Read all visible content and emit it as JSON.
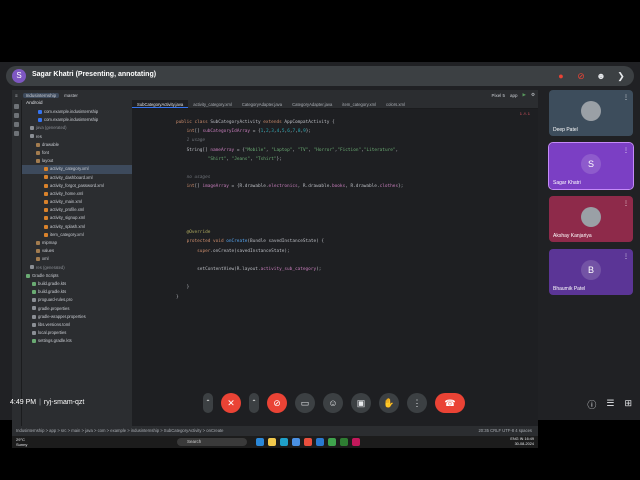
{
  "presenter": {
    "initial": "S",
    "label": "Sagar Khatri (Presenting, annotating)"
  },
  "top_icons": [
    "stop-record-icon",
    "camera-off-icon",
    "people-icon",
    "chevron-icon"
  ],
  "ide": {
    "project": "Indusinternship",
    "branch": "master",
    "device": "Pixel 5",
    "run_config": "app",
    "tree_header": "Android",
    "tree": [
      {
        "label": "com.example.indusinternship",
        "dim": false
      },
      {
        "label": "com.example.indusinternship",
        "dim": false
      },
      {
        "label": "java (generated)",
        "dim": true
      },
      {
        "label": "res",
        "dim": false
      },
      {
        "label": "drawable",
        "dim": false
      },
      {
        "label": "font",
        "dim": false
      },
      {
        "label": "layout",
        "dim": false
      },
      {
        "label": "activity_category.xml",
        "dim": false
      },
      {
        "label": "activity_dashboard.xml",
        "dim": false
      },
      {
        "label": "activity_forgot_password.xml",
        "dim": false
      },
      {
        "label": "activity_home.xml",
        "dim": false
      },
      {
        "label": "activity_main.xml",
        "dim": false
      },
      {
        "label": "activity_profile.xml",
        "dim": false
      },
      {
        "label": "activity_signup.xml",
        "dim": false
      },
      {
        "label": "activity_splash.xml",
        "dim": false
      },
      {
        "label": "item_category.xml",
        "dim": false
      },
      {
        "label": "mipmap",
        "dim": false
      },
      {
        "label": "values",
        "dim": false
      },
      {
        "label": "xml",
        "dim": false
      },
      {
        "label": "res (generated)",
        "dim": true
      },
      {
        "label": "Gradle Scripts",
        "dim": false
      },
      {
        "label": "build.gradle.kts",
        "dim": false
      },
      {
        "label": "build.gradle.kts",
        "dim": false
      },
      {
        "label": "proguard-rules.pro",
        "dim": false
      },
      {
        "label": "gradle.properties",
        "dim": false
      },
      {
        "label": "gradle-wrapper.properties",
        "dim": false
      },
      {
        "label": "libs.versions.toml",
        "dim": false
      },
      {
        "label": "local.properties",
        "dim": false
      },
      {
        "label": "settings.gradle.kts",
        "dim": false
      }
    ],
    "tabs": [
      "SubCategoryActivity.java",
      "activity_category.xml",
      "CategoryAdapter.java",
      "CategoryAdapter.java",
      "item_category.xml",
      "colors.xml"
    ],
    "error_badge": "1 ⚠ 1",
    "line_numbers": [
      "",
      "",
      "",
      "",
      "",
      "",
      "",
      "",
      "",
      "",
      "",
      "",
      "",
      "",
      "",
      "",
      "",
      "",
      "",
      "",
      ""
    ],
    "status_path": "Indusinternship > app > src > main > java > com > example > indusinternship > SubCategoryActivity > onCreate",
    "status_right": "20:35   CRLF   UTF-8   4 spaces"
  },
  "taskbar": {
    "weather_temp": "29°C",
    "weather_desc": "Sunny",
    "search": "Search",
    "lang": "ENG IN",
    "time": "16:49",
    "date": "30-08-2024"
  },
  "participants": [
    {
      "name": "Deep Patel",
      "initial": "",
      "color": "#3d4d5c"
    },
    {
      "name": "Sagar Khatri",
      "initial": "S",
      "color": "#7b3fc4"
    },
    {
      "name": "Akshay Kanjariya",
      "initial": "",
      "color": "#8e2a4a"
    },
    {
      "name": "Bhaumik Patel",
      "initial": "B",
      "color": "#5b3596"
    }
  ],
  "meeting": {
    "time": "4:49 PM",
    "code": "ryj-smam-qzt"
  },
  "colors": {
    "hangup": "#ea4335",
    "meet_bg": "#202124",
    "accent": "#8ab4f8"
  }
}
